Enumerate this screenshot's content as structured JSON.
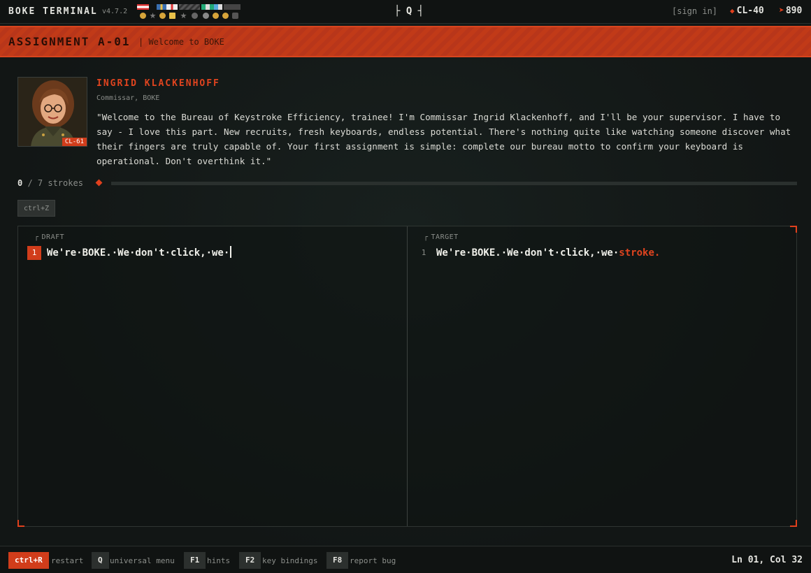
{
  "topbar": {
    "app_title": "BOKE TERMINAL",
    "version": "v4.7.2",
    "menu_glyph": "├ Q ┤",
    "sign_in": "[sign in]",
    "rank": "CL-40",
    "points": "890",
    "icons": {
      "rank": "diamond-icon",
      "points": "cursor-arrow-icon",
      "ribbons": "medal-ribbons-icon"
    }
  },
  "assignment": {
    "title": "ASSIGNMENT A-01",
    "subtitle": "| Welcome to BOKE"
  },
  "npc": {
    "name": "INGRID KLACKENHOFF",
    "role": "Commissar, BOKE",
    "portrait_tag": "CL-61",
    "quote": "\"Welcome to the Bureau of Keystroke Efficiency, trainee! I'm Commissar Ingrid Klackenhoff, and I'll be your supervisor. I have to say - I love this part. New recruits, fresh keyboards, endless potential. There's nothing quite like watching someone discover what their fingers are truly capable of. Your first assignment is simple: complete our bureau motto to confirm your keyboard is operational. Don't overthink it.\""
  },
  "progress": {
    "done": "0",
    "total_text": " / 7 strokes",
    "fraction": 0.0
  },
  "undo_hint": "ctrl+Z",
  "editor": {
    "draft": {
      "label": "DRAFT",
      "line_number": "1",
      "text": "We're·BOKE.·We·don't·click,·we·"
    },
    "target": {
      "label": "TARGET",
      "line_number": "1",
      "text_done": "We're·BOKE.·We·don't·click,·we·",
      "text_rest": "stroke."
    }
  },
  "bottombar": {
    "keys": [
      {
        "key": "ctrl+R",
        "label": "restart"
      },
      {
        "key": "Q",
        "label": "universal menu"
      },
      {
        "key": "F1",
        "label": "hints"
      },
      {
        "key": "F2",
        "label": "key bindings"
      },
      {
        "key": "F8",
        "label": "report bug"
      }
    ],
    "cursor_pos": "Ln 01, Col 32"
  },
  "colors": {
    "accent": "#e0401d",
    "background": "#121615",
    "banner": "#c13a18"
  }
}
